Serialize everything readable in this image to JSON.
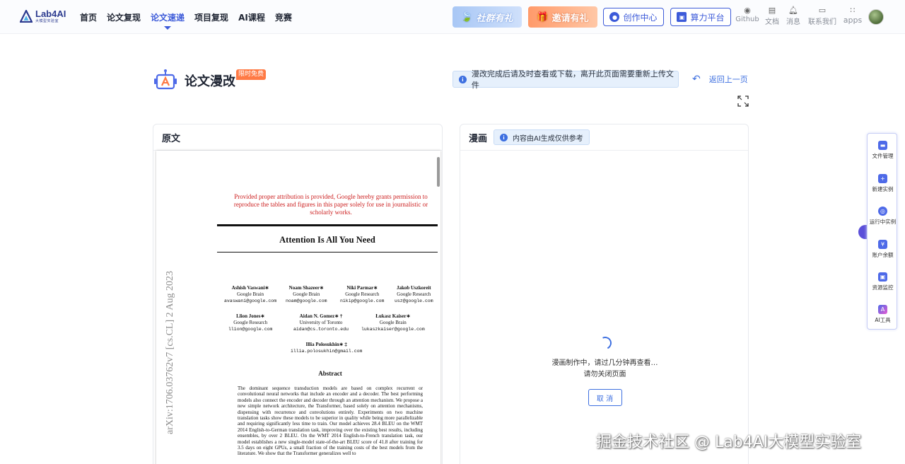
{
  "header": {
    "logo_title": "Lab4AI",
    "logo_sub": "大模型实验室",
    "nav": [
      "首页",
      "论文复现",
      "论文速递",
      "项目复现",
      "AI课程",
      "竞赛"
    ],
    "community_label": "社群有礼",
    "invite_label": "邀请有礼",
    "create_label": "创作中心",
    "compute_label": "算力平台",
    "github_label": "Github",
    "doc_label": "文档",
    "msg_label": "消息",
    "contact_label": "联系我们",
    "apps_label": "apps"
  },
  "page": {
    "title": "论文漫改",
    "free_badge": "限时免费",
    "notice": "漫改完成后请及时查看或下载，离开此页面需要重新上传文件",
    "back_label": "返回上一页"
  },
  "left_panel": {
    "title": "原文",
    "arxiv_id": "arXiv:1706.03762v7  [cs.CL]  2 Aug 2023",
    "permission": "Provided proper attribution is provided, Google hereby grants permission to reproduce the tables and figures in this paper solely for use in journalistic or scholarly works.",
    "paper_title": "Attention Is All You Need",
    "authors": [
      {
        "name": "Ashish Vaswani∗",
        "org": "Google Brain",
        "email": "avaswani@google.com"
      },
      {
        "name": "Noam Shazeer∗",
        "org": "Google Brain",
        "email": "noam@google.com"
      },
      {
        "name": "Niki Parmar∗",
        "org": "Google Research",
        "email": "nikip@google.com"
      },
      {
        "name": "Jakob Uszkoreit",
        "org": "Google Research",
        "email": "usz@google.com"
      },
      {
        "name": "Llion Jones∗",
        "org": "Google Research",
        "email": "llion@google.com"
      },
      {
        "name": "Aidan N. Gomez∗ †",
        "org": "University of Toronto",
        "email": "aidan@cs.toronto.edu"
      },
      {
        "name": "Łukasz Kaiser∗",
        "org": "Google Brain",
        "email": "lukaszkaiser@google.com"
      },
      {
        "name": "Illia Polosukhin∗ ‡",
        "org": "",
        "email": "illia.polosukhin@gmail.com"
      }
    ],
    "abstract_title": "Abstract",
    "abstract": "The dominant sequence transduction models are based on complex recurrent or convolutional neural networks that include an encoder and a decoder. The best performing models also connect the encoder and decoder through an attention mechanism. We propose a new simple network architecture, the Transformer, based solely on attention mechanisms, dispensing with recurrence and convolutions entirely. Experiments on two machine translation tasks show these models to be superior in quality while being more parallelizable and requiring significantly less time to train. Our model achieves 28.4 BLEU on the WMT 2014 English-to-German translation task, improving over the existing best results, including ensembles, by over 2 BLEU. On the WMT 2014 English-to-French translation task, our model establishes a new single-model state-of-the-art BLEU score of 41.8 after training for 3.5 days on eight GPUs, a small fraction of the training costs of the best models from the literature. We show that the Transformer generalizes well to"
  },
  "right_panel": {
    "title": "漫画",
    "ai_tag": "内容由AI生成仅供参考",
    "loading_line1": "漫画制作中，请过几分钟再查看…",
    "loading_line2": "请勿关闭页面",
    "cancel_label": "取 消"
  },
  "side_toolbar": [
    "文件管理",
    "新建实例",
    "运行中实例",
    "账户余额",
    "资源监控",
    "AI工具"
  ],
  "watermark": "掘金技术社区 @ Lab4AI大模型实验室",
  "colors": {
    "accent": "#3d5bd9",
    "link": "#3d6fe0",
    "badge": "#ff7a45",
    "notice_bg": "#e6f0fc"
  }
}
